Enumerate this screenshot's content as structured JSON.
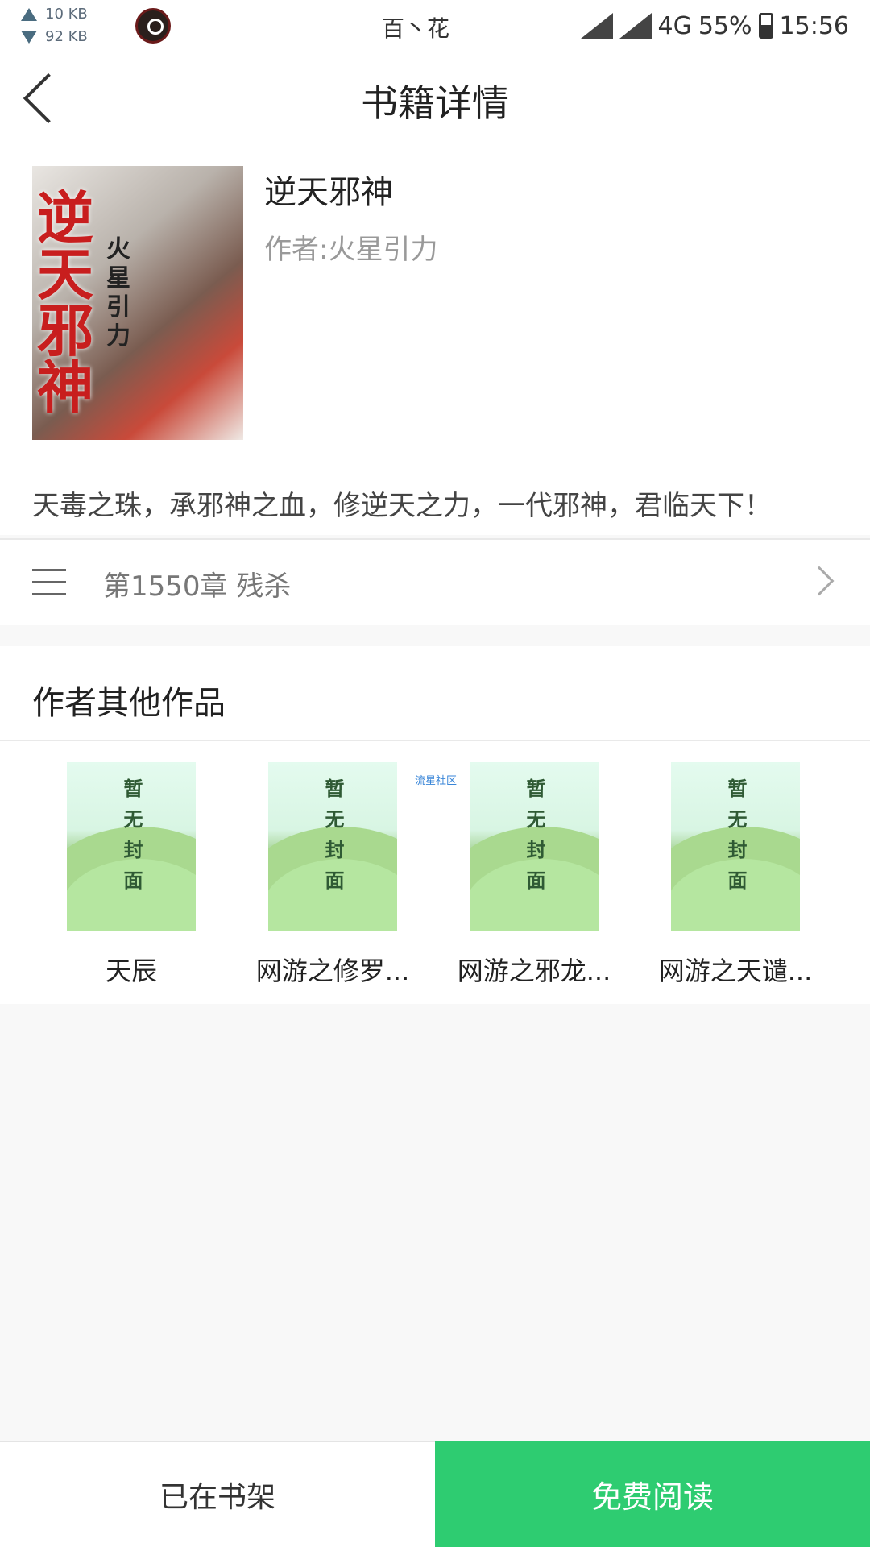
{
  "status_bar": {
    "upload_speed": "10 KB",
    "download_speed": "92 KB",
    "carrier": "百丶花",
    "network_type": "4G",
    "battery": "55%",
    "time": "15:56"
  },
  "header": {
    "title": "书籍详情",
    "back_icon": "chevron-left-icon"
  },
  "book": {
    "title": "逆天邪神",
    "author": "作者:火星引力",
    "description": "天毒之珠，承邪神之血，修逆天之力，一代邪神，君临天下！",
    "cover_title": "逆天邪神",
    "cover_author": "火星引力"
  },
  "chapter": {
    "latest": "第1550章 残杀"
  },
  "other_works": {
    "title": "作者其他作品",
    "placeholder_text": "暂无封面",
    "watermark": "流星社区",
    "items": [
      {
        "name": "天辰"
      },
      {
        "name": "网游之修罗..."
      },
      {
        "name": "网游之邪龙..."
      },
      {
        "name": "网游之天谴..."
      }
    ]
  },
  "actions": {
    "shelf_label": "已在书架",
    "read_label": "免费阅读"
  },
  "colors": {
    "accent": "#2ecc71",
    "background": "#f8f8f8"
  }
}
